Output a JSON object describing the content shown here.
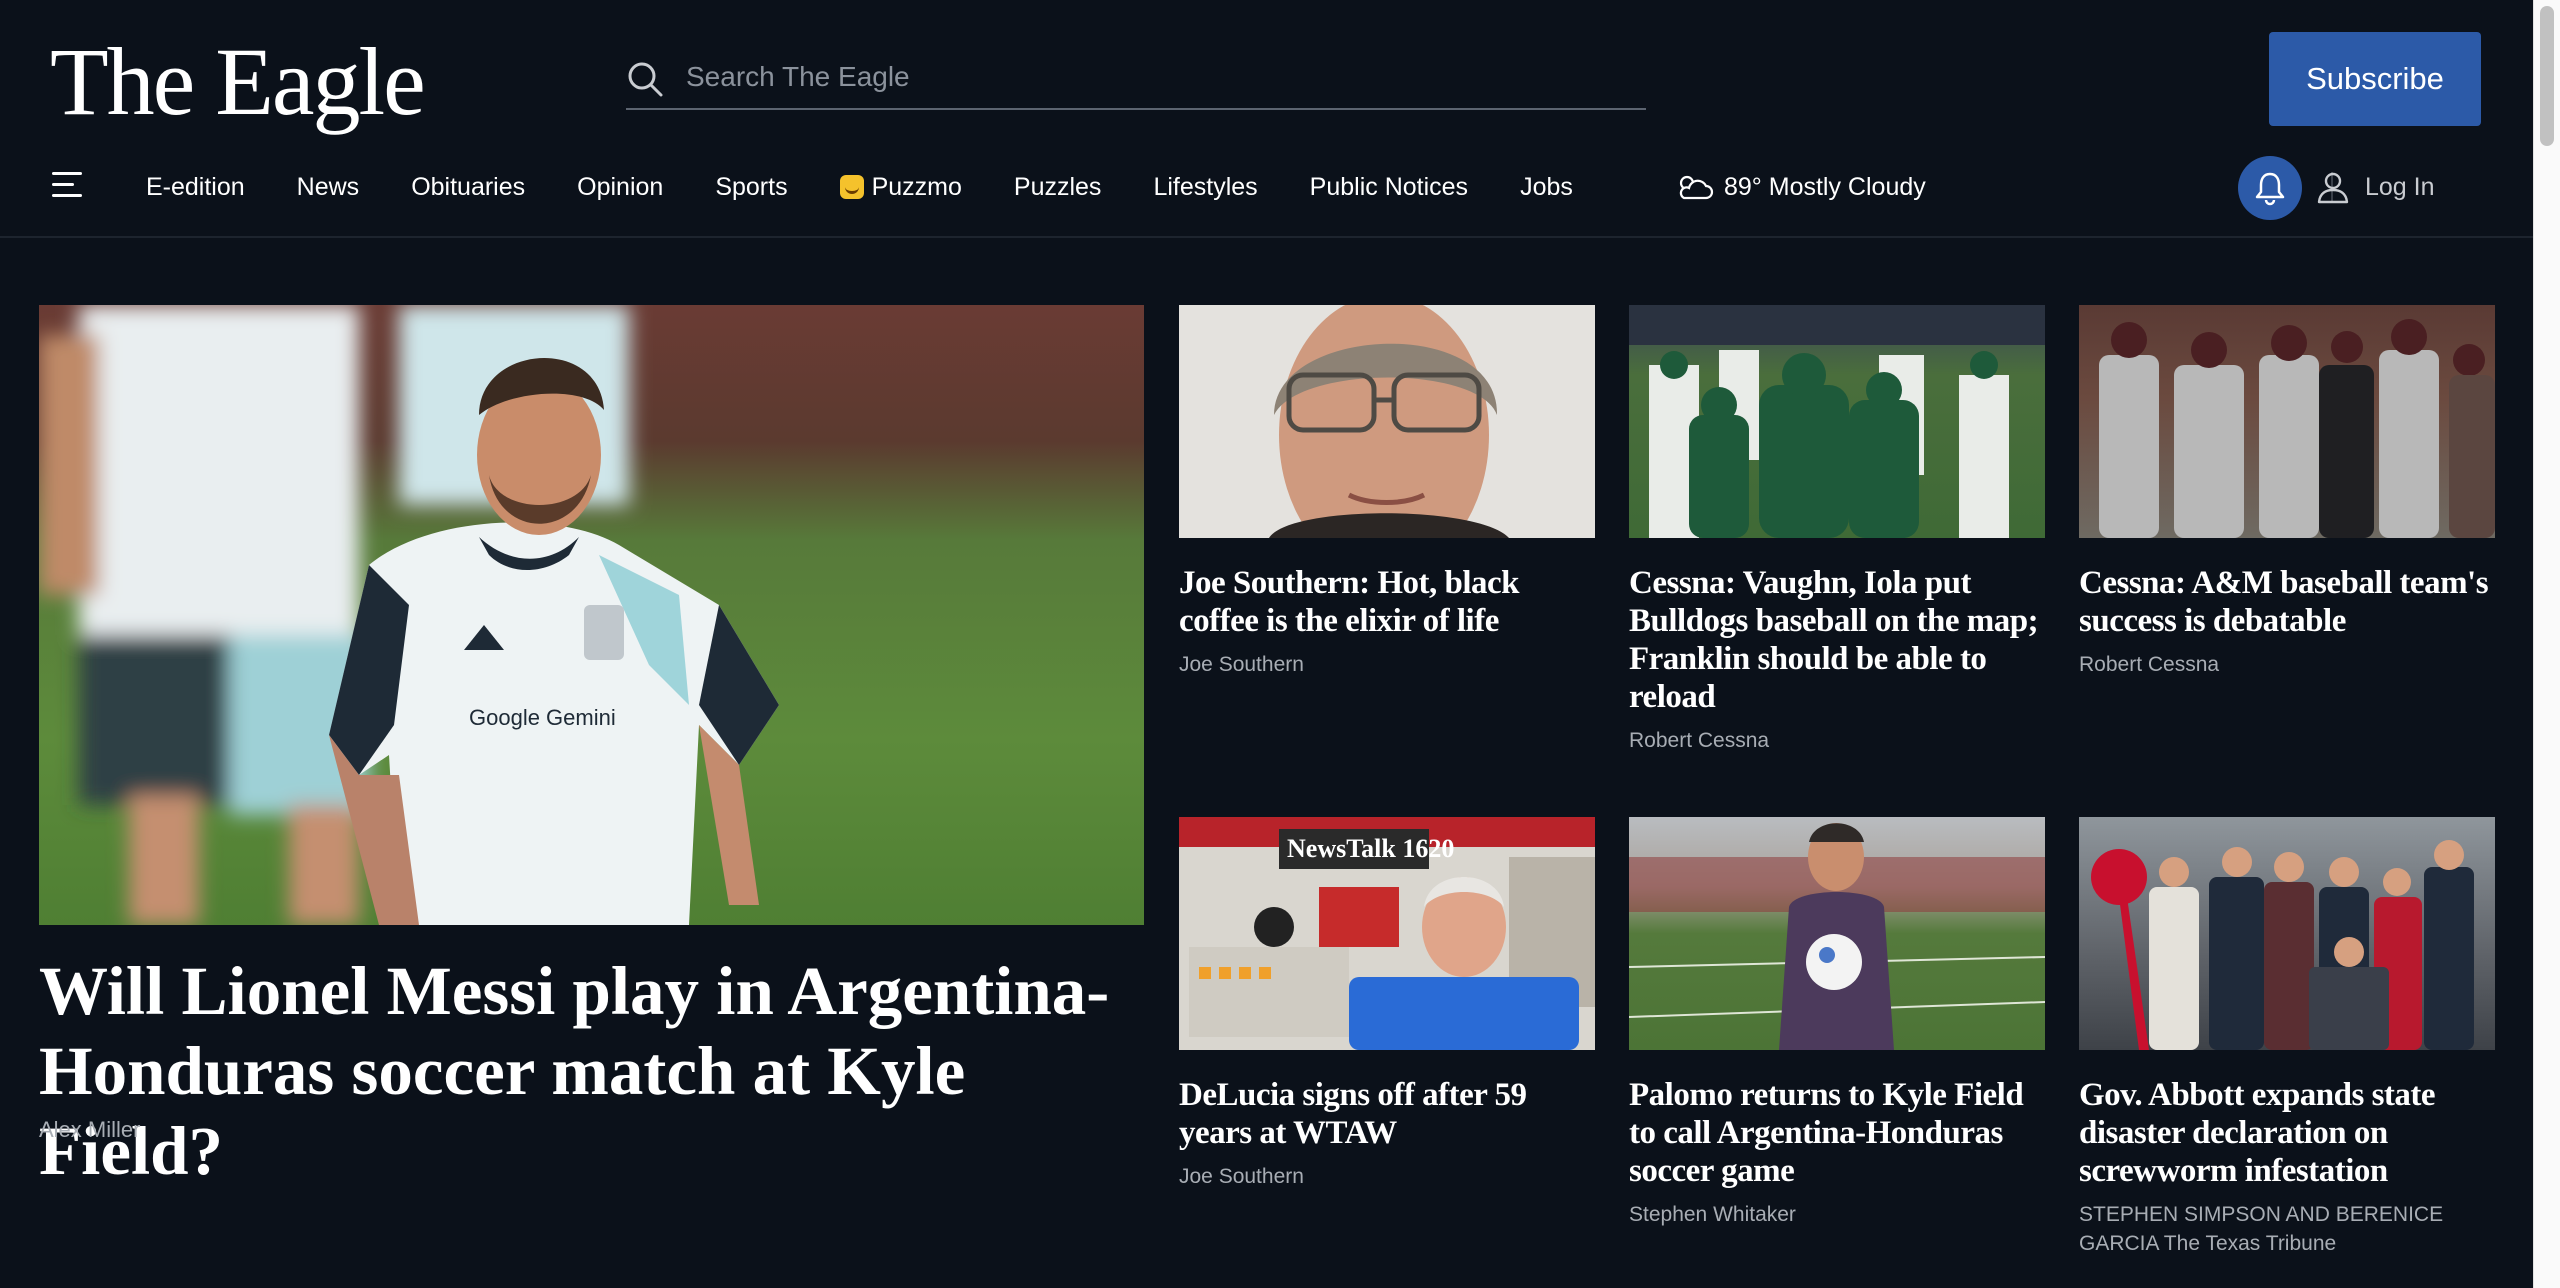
{
  "site": {
    "logo": "The Eagle",
    "search_placeholder": "Search The Eagle",
    "subscribe_label": "Subscribe"
  },
  "nav": {
    "items": [
      {
        "label": "E-edition"
      },
      {
        "label": "News"
      },
      {
        "label": "Obituaries"
      },
      {
        "label": "Opinion"
      },
      {
        "label": "Sports"
      },
      {
        "label": "Puzzmo",
        "icon": "puzzmo-icon"
      },
      {
        "label": "Puzzles"
      },
      {
        "label": "Lifestyles"
      },
      {
        "label": "Public Notices"
      },
      {
        "label": "Jobs"
      }
    ],
    "weather": "89° Mostly Cloudy",
    "weather_icon": "cloud-sun-icon",
    "login_label": "Log In",
    "accent_color": "#2c5aa8"
  },
  "feature": {
    "headline": "Will Lionel Messi play in Argentina-Honduras soccer match at Kyle Field?",
    "byline": "Alex Miller"
  },
  "cards": [
    {
      "headline": "Joe Southern: Hot, black coffee is the elixir of life",
      "byline": "Joe Southern"
    },
    {
      "headline": "Cessna: Vaughn, Iola put Bulldogs baseball on the map; Franklin should be able to reload",
      "byline": "Robert Cessna"
    },
    {
      "headline": "Cessna: A&M baseball team's success is debatable",
      "byline": "Robert Cessna"
    },
    {
      "headline": "DeLucia signs off after 59 years at WTAW",
      "byline": "Joe Southern"
    },
    {
      "headline": "Palomo returns to Kyle Field to call Argentina-Honduras soccer game",
      "byline": "Stephen Whitaker"
    },
    {
      "headline": "Gov. Abbott expands state disaster declaration on screwworm infestation",
      "byline": "STEPHEN SIMPSON AND BERENICE GARCIA The Texas Tribune"
    }
  ],
  "images": {
    "radio_sign": "NewsTalk 1620"
  }
}
